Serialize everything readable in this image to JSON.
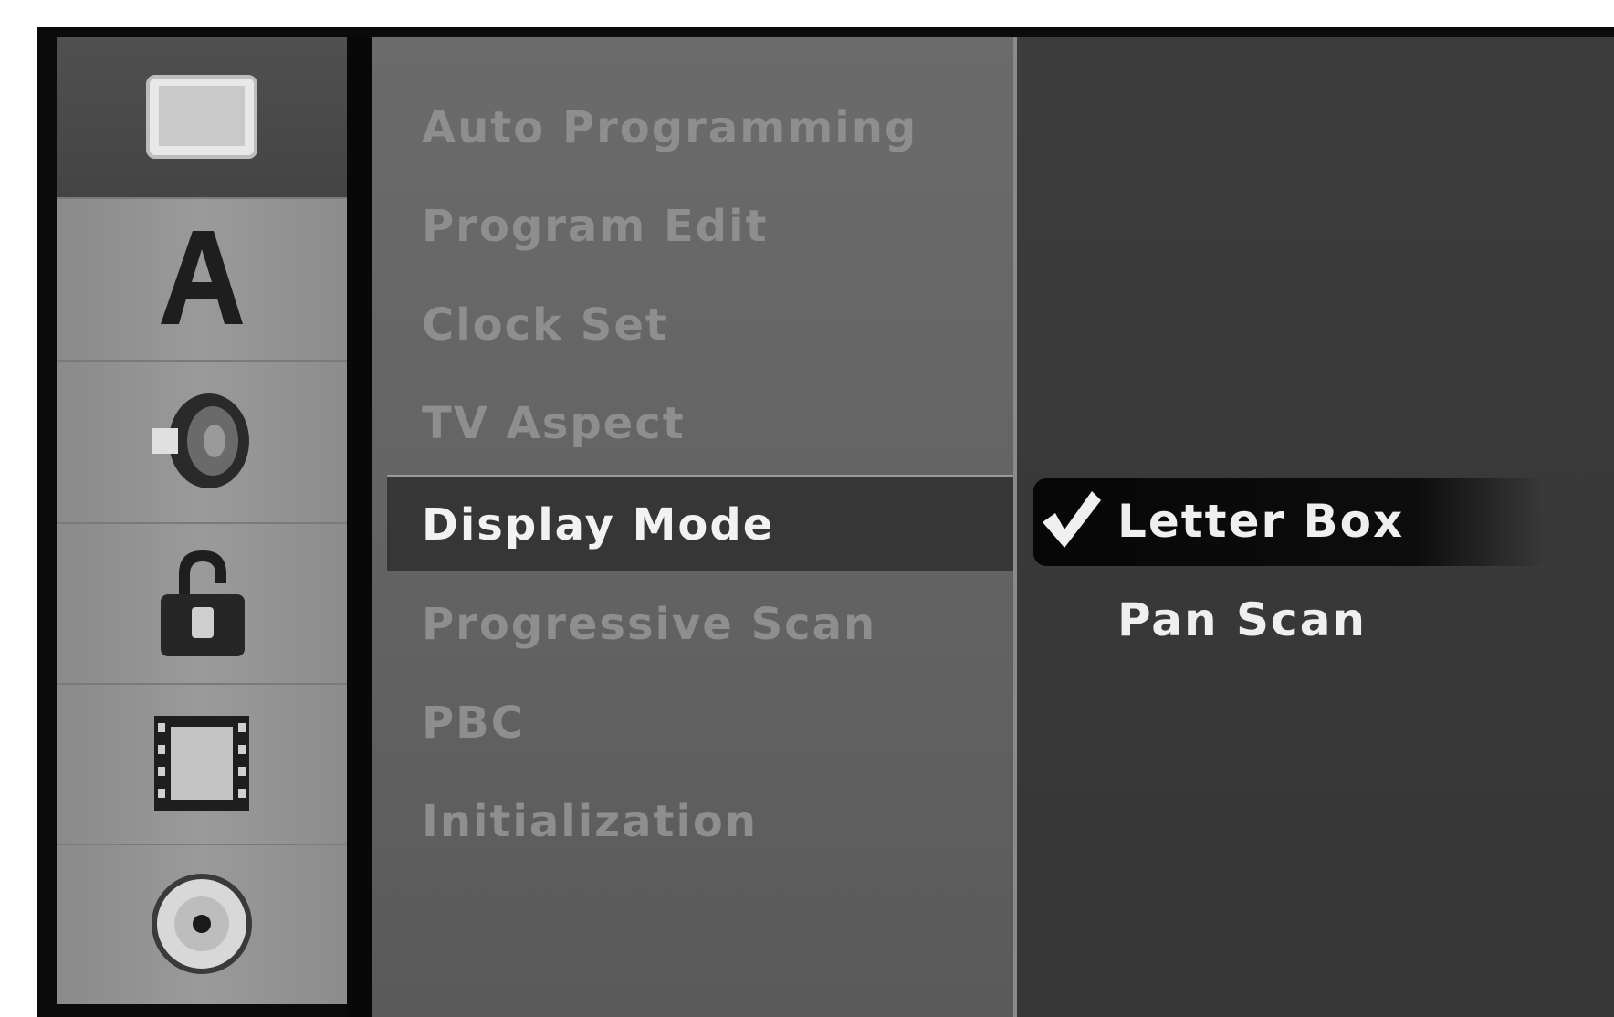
{
  "sidebar": {
    "icons": [
      {
        "name": "display-icon",
        "active": true
      },
      {
        "name": "language-icon",
        "active": false
      },
      {
        "name": "audio-icon",
        "active": false
      },
      {
        "name": "lock-icon",
        "active": false
      },
      {
        "name": "recording-icon",
        "active": false
      },
      {
        "name": "disc-icon",
        "active": false
      }
    ]
  },
  "menu": {
    "items": [
      {
        "label": "Auto Programming"
      },
      {
        "label": "Program Edit"
      },
      {
        "label": "Clock Set"
      },
      {
        "label": "TV Aspect"
      },
      {
        "label": "Display Mode"
      },
      {
        "label": "Progressive Scan"
      },
      {
        "label": "PBC"
      },
      {
        "label": "Initialization"
      }
    ],
    "selected_index": 4
  },
  "submenu": {
    "options": [
      {
        "label": "Letter Box",
        "checked": true
      },
      {
        "label": "Pan Scan",
        "checked": false
      }
    ]
  }
}
